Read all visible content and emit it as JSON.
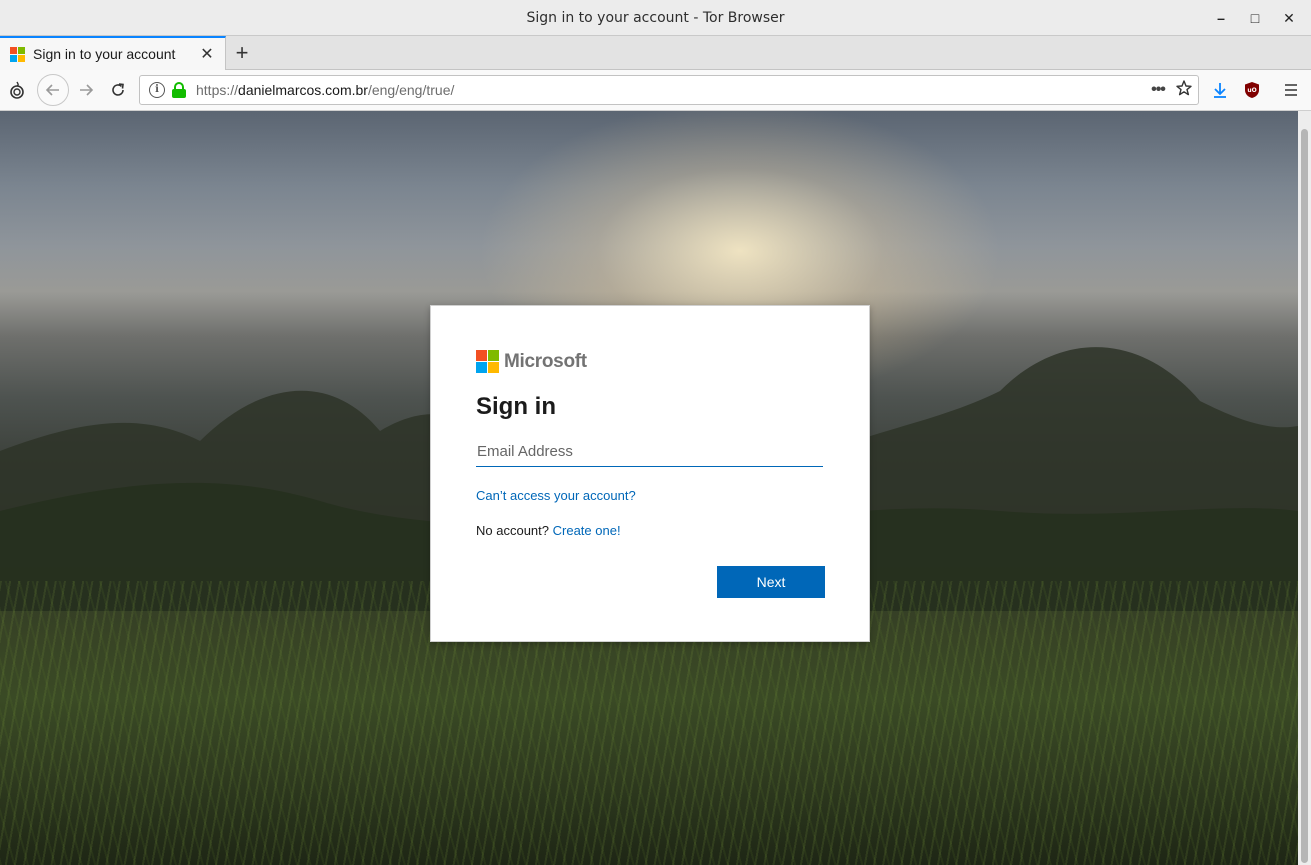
{
  "window": {
    "title": "Sign in to your account - Tor Browser",
    "controls": {
      "minimize": "–",
      "maximize": "□",
      "close": "✕"
    }
  },
  "tabs": [
    {
      "label": "Sign in to your account",
      "active": true,
      "favicon": "microsoft-icon"
    }
  ],
  "tab_close_glyph": "✕",
  "new_tab_glyph": "+",
  "navbar": {
    "url_scheme": "https://",
    "url_host": "danielmarcos.com.br",
    "url_path": "/eng/eng/true/",
    "more_glyph": "•••",
    "icons": [
      "tor-onion-icon",
      "back-arrow-icon",
      "forward-arrow-icon",
      "reload-icon",
      "info-icon",
      "lock-icon",
      "page-actions-icon",
      "bookmark-star-icon",
      "download-icon",
      "ublock-icon",
      "hamburger-menu-icon"
    ]
  },
  "signin": {
    "brand": "Microsoft",
    "heading": "Sign in",
    "email_placeholder": "Email Address",
    "email_value": "",
    "cant_access": "Can’t access your account?",
    "no_account": "No account?",
    "create_one": "Create one!",
    "next_label": "Next"
  },
  "colors": {
    "accent": "#0067b8",
    "lock_green": "#12bc00",
    "tab_highlight": "#0a84ff"
  }
}
